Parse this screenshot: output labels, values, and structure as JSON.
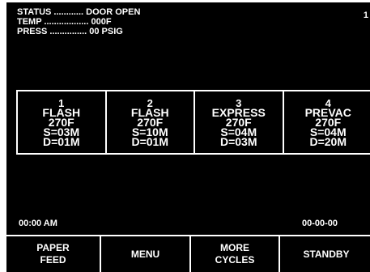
{
  "status": {
    "lines": [
      "STATUS ............ DOOR OPEN",
      "TEMP .................. 000F",
      "PRESS ............... 00 PSIG"
    ],
    "screen_number": "1"
  },
  "cycles": [
    {
      "number": "1",
      "name": "FLASH",
      "temp": "270F",
      "sterilize": "S=03M",
      "dry": "D=01M"
    },
    {
      "number": "2",
      "name": "FLASH",
      "temp": "270F",
      "sterilize": "S=10M",
      "dry": "D=01M"
    },
    {
      "number": "3",
      "name": "EXPRESS",
      "temp": "270F",
      "sterilize": "S=04M",
      "dry": "D=03M"
    },
    {
      "number": "4",
      "name": "PREVAC",
      "temp": "270F",
      "sterilize": "S=04M",
      "dry": "D=20M"
    }
  ],
  "footer": {
    "time": "00:00 AM",
    "date": "00-00-00"
  },
  "softkeys": [
    {
      "line1": "PAPER",
      "line2": "FEED"
    },
    {
      "line1": "MENU",
      "line2": ""
    },
    {
      "line1": "MORE",
      "line2": "CYCLES"
    },
    {
      "line1": "STANDBY",
      "line2": ""
    }
  ]
}
